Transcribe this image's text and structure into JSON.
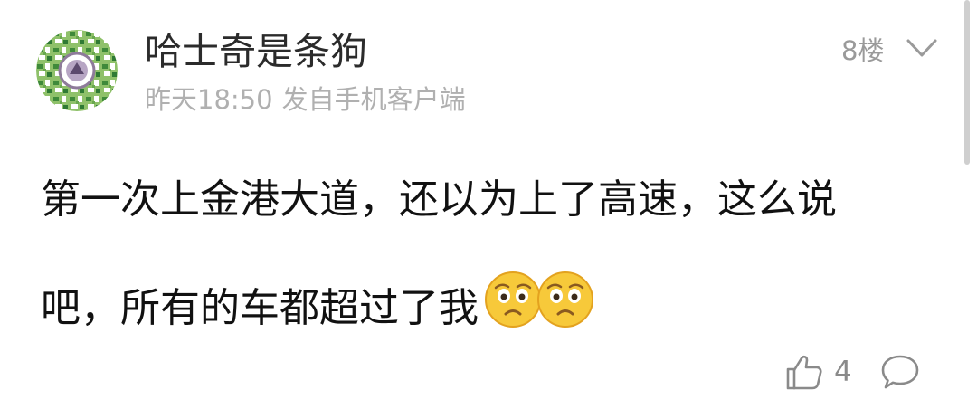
{
  "post": {
    "username": "哈士奇是条狗",
    "time": "昨天18:50",
    "source": "发自手机客户端",
    "floor": "8楼",
    "content": "第一次上金港大道，还以为上了高速，这么说吧，所有的车都超过了我",
    "emojis": [
      "worried-face-emoji",
      "worried-face-emoji"
    ]
  },
  "actions": {
    "like_icon": "thumbs-up-icon",
    "like_count": "4",
    "comment_icon": "comment-bubble-icon"
  },
  "colors": {
    "username": "#2b2b2b",
    "meta": "#b0b0b0",
    "content": "#111111",
    "icon": "#8a8a8a"
  }
}
